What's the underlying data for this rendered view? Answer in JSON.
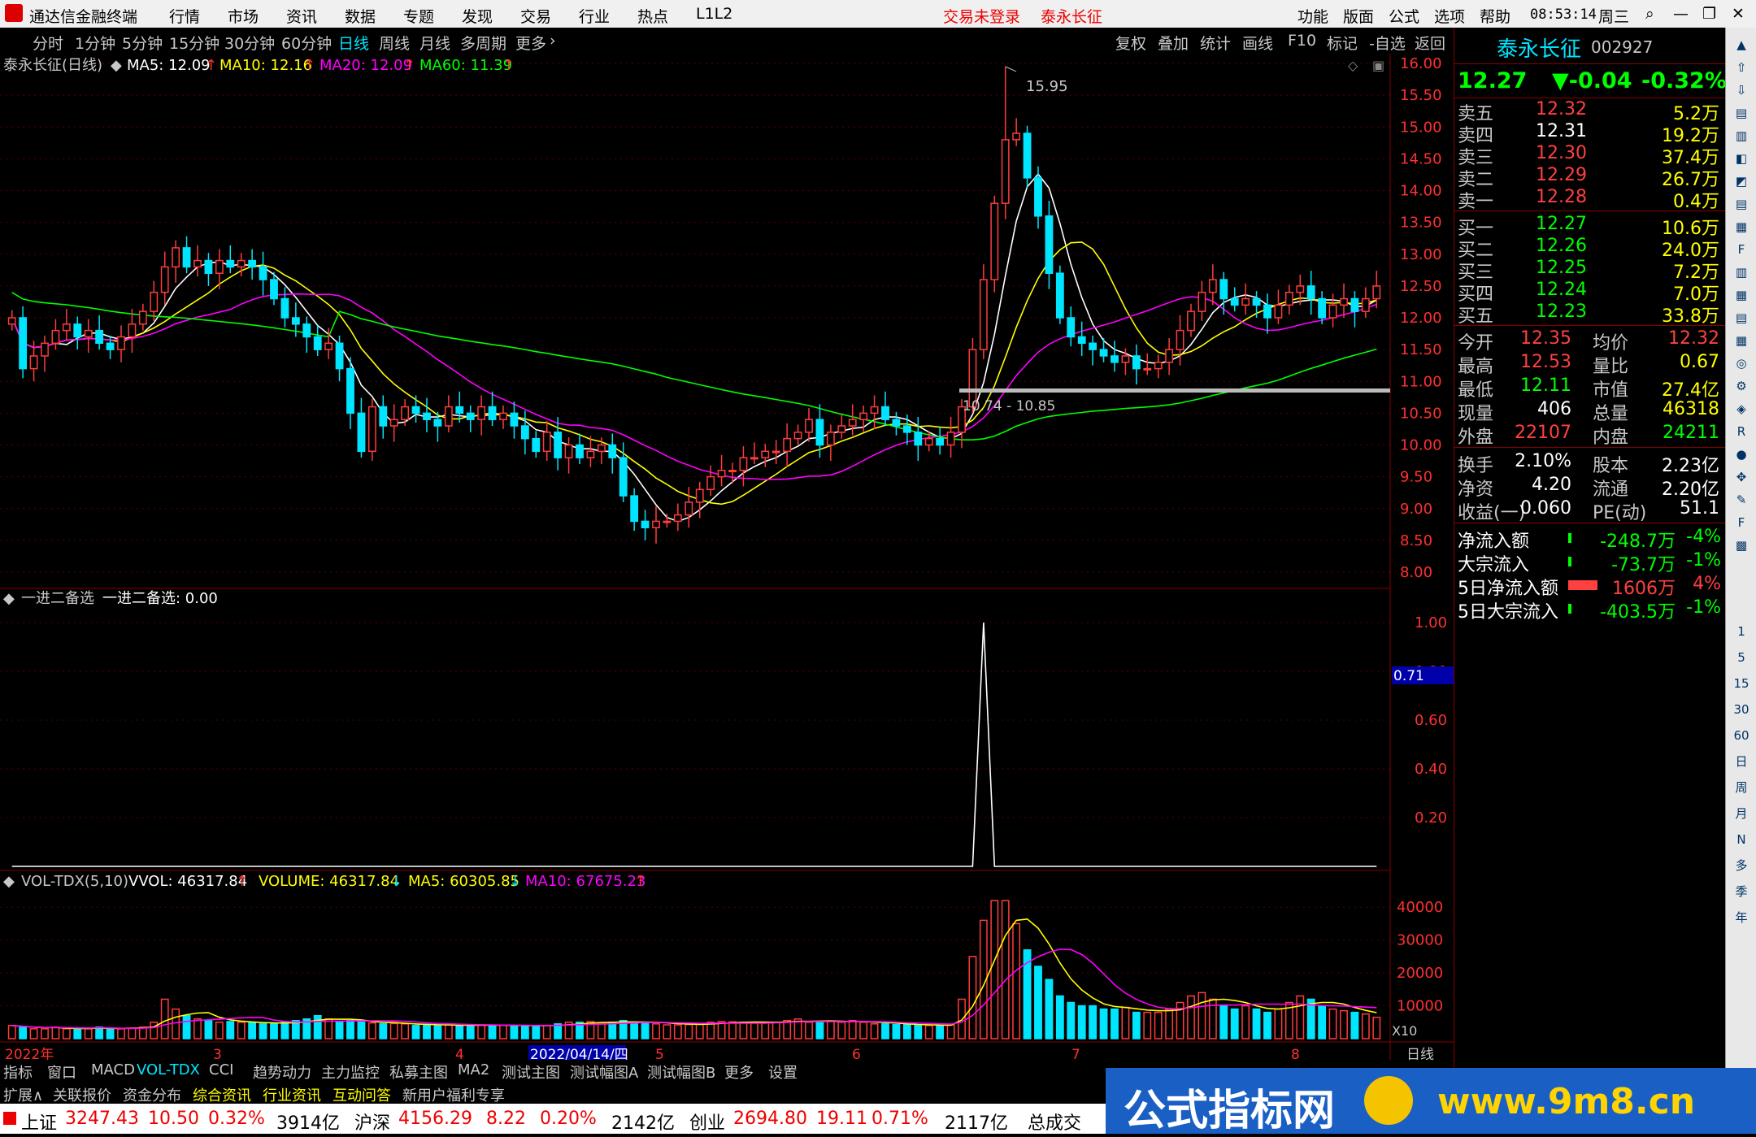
{
  "app": {
    "title": "通达信金融终端",
    "menu": [
      "行情",
      "市场",
      "资讯",
      "数据",
      "专题",
      "发现",
      "交易",
      "行业",
      "热点",
      "L1L2"
    ],
    "status_left": "交易未登录",
    "status_stock": "泰永长征",
    "right_menu": [
      "功能",
      "版面",
      "公式",
      "选项",
      "帮助"
    ],
    "time": "08:53:14",
    "weekday": "周三"
  },
  "toolbar": {
    "periods": [
      "分时",
      "1分钟",
      "5分钟",
      "15分钟",
      "30分钟",
      "60分钟",
      "日线",
      "周线",
      "月线",
      "多周期",
      "更多"
    ],
    "active_period": "日线",
    "right": [
      "复权",
      "叠加",
      "统计",
      "画线",
      "F10",
      "标记",
      "-自选",
      "返回"
    ]
  },
  "main_panel": {
    "name": "泰永长征(日线)",
    "ma": [
      {
        "label": "MA5: 12.09",
        "color": "#ffffff",
        "arrow": "↑"
      },
      {
        "label": "MA10: 12.16",
        "color": "#ffff00",
        "arrow": "↑"
      },
      {
        "label": "MA20: 12.09",
        "color": "#ff00ff",
        "arrow": "↑"
      },
      {
        "label": "MA60: 11.39",
        "color": "#00ff00",
        "arrow": "↑"
      }
    ],
    "y_ticks": [
      "16.00",
      "15.50",
      "15.00",
      "14.50",
      "14.00",
      "13.50",
      "13.00",
      "12.50",
      "12.00",
      "11.50",
      "11.00",
      "10.50",
      "10.00",
      "9.50",
      "9.00",
      "8.50",
      "8.00"
    ],
    "high_label": "15.95",
    "range_label": "10.74 - 10.85"
  },
  "indicator_panel": {
    "title": "一进二备选",
    "value_label": "一进二备选: 0.00",
    "y_ticks": [
      "1.00",
      "0.80",
      "0.60",
      "0.40",
      "0.20"
    ],
    "current": "0.71"
  },
  "volume_panel": {
    "name": "VOL-TDX(5,10)",
    "vvol": "VVOL: 46317.84",
    "volume": "VOLUME: 46317.84",
    "ma5": "MA5: 60305.85",
    "ma10": "MA10: 67675.23",
    "y_ticks": [
      "40000",
      "30000",
      "20000",
      "10000"
    ],
    "scale": "X10"
  },
  "x_axis": {
    "labels": [
      "2022年",
      "3",
      "4",
      "2022/04/14/四",
      "5",
      "6",
      "7",
      "8"
    ],
    "period": "日线"
  },
  "chart_data": {
    "type": "candlestick",
    "title": "泰永长征(日线)",
    "price_range": [
      8.0,
      16.0
    ],
    "max_high": 15.95,
    "last_close": 12.27,
    "moving_averages": {
      "MA5": 12.09,
      "MA10": 12.16,
      "MA20": 12.09,
      "MA60": 11.39
    },
    "closes": [
      12.0,
      11.2,
      11.4,
      11.6,
      11.8,
      11.9,
      11.7,
      11.8,
      11.6,
      11.5,
      11.7,
      11.9,
      12.1,
      12.4,
      12.8,
      13.1,
      12.8,
      12.9,
      12.7,
      12.9,
      12.8,
      12.9,
      12.8,
      12.6,
      12.3,
      12.0,
      11.9,
      11.7,
      11.5,
      11.6,
      11.2,
      10.5,
      9.9,
      10.6,
      10.3,
      10.4,
      10.6,
      10.5,
      10.4,
      10.3,
      10.6,
      10.5,
      10.4,
      10.6,
      10.4,
      10.5,
      10.3,
      10.1,
      9.9,
      10.2,
      9.8,
      10.0,
      9.8,
      9.9,
      10.0,
      9.8,
      9.2,
      8.8,
      8.7,
      8.8,
      8.8,
      8.9,
      9.1,
      9.3,
      9.5,
      9.6,
      9.6,
      9.8,
      9.8,
      9.9,
      9.9,
      10.1,
      10.2,
      10.4,
      10.0,
      10.2,
      10.3,
      10.4,
      10.5,
      10.6,
      10.4,
      10.3,
      10.2,
      10.0,
      10.1,
      10.0,
      10.2,
      10.6,
      11.5,
      12.6,
      13.8,
      14.8,
      14.9,
      14.2,
      13.6,
      12.7,
      12.0,
      11.7,
      11.6,
      11.5,
      11.4,
      11.3,
      11.4,
      11.2,
      11.2,
      11.3,
      11.5,
      11.8,
      12.1,
      12.4,
      12.6,
      12.3,
      12.2,
      12.3,
      12.2,
      12.0,
      12.2,
      12.4,
      12.5,
      12.3,
      12.0,
      12.2,
      12.3,
      12.1,
      12.3,
      12.5
    ],
    "volume_range": [
      0,
      45000
    ],
    "volumes": [
      4000,
      3500,
      3000,
      3000,
      3500,
      3000,
      3000,
      3000,
      3500,
      3200,
      3000,
      3200,
      3500,
      5000,
      12000,
      9000,
      7000,
      6000,
      5500,
      5000,
      5200,
      5000,
      4800,
      4500,
      4500,
      5000,
      5500,
      6000,
      7000,
      6000,
      5000,
      5500,
      5000,
      4800,
      4500,
      4600,
      4500,
      4000,
      4200,
      4000,
      4200,
      4100,
      4000,
      4200,
      4000,
      4100,
      4000,
      3900,
      3800,
      4000,
      4500,
      5000,
      5000,
      5200,
      4800,
      5000,
      5500,
      5000,
      5000,
      4500,
      4200,
      4200,
      4300,
      4500,
      5000,
      5200,
      5100,
      5000,
      5000,
      4800,
      5000,
      5500,
      6000,
      5000,
      5200,
      5200,
      5000,
      5500,
      5000,
      4500,
      4500,
      4300,
      4200,
      4100,
      4000,
      4000,
      4200,
      12000,
      25000,
      36000,
      42000,
      42000,
      35000,
      27000,
      22000,
      18000,
      13000,
      11000,
      10000,
      10000,
      9000,
      9000,
      9500,
      8000,
      8000,
      8000,
      9000,
      11000,
      13000,
      14000,
      12000,
      10000,
      9000,
      10000,
      9000,
      8000,
      9000,
      11000,
      13000,
      12000,
      10000,
      9000,
      8500,
      8000,
      7500,
      6500
    ],
    "signal_spike_index": 89,
    "signal_value": 1.0
  },
  "quote": {
    "name": "泰永长征",
    "code": "002927",
    "price": "12.27",
    "change": "▼-0.04",
    "change_pct": "-0.32%",
    "sells": [
      {
        "label": "卖五",
        "price": "12.32",
        "vol": "5.2万"
      },
      {
        "label": "卖四",
        "price": "12.31",
        "vol": "19.2万"
      },
      {
        "label": "卖三",
        "price": "12.30",
        "vol": "37.4万"
      },
      {
        "label": "卖二",
        "price": "12.29",
        "vol": "26.7万"
      },
      {
        "label": "卖一",
        "price": "12.28",
        "vol": "0.4万"
      }
    ],
    "buys": [
      {
        "label": "买一",
        "price": "12.27",
        "vol": "10.6万"
      },
      {
        "label": "买二",
        "price": "12.26",
        "vol": "24.0万"
      },
      {
        "label": "买三",
        "price": "12.25",
        "vol": "7.2万"
      },
      {
        "label": "买四",
        "price": "12.24",
        "vol": "7.0万"
      },
      {
        "label": "买五",
        "price": "12.23",
        "vol": "33.8万"
      }
    ],
    "stats": [
      {
        "l1": "今开",
        "v1": "12.35",
        "l2": "均价",
        "v2": "12.32"
      },
      {
        "l1": "最高",
        "v1": "12.53",
        "l2": "量比",
        "v2": "0.67"
      },
      {
        "l1": "最低",
        "v1": "12.11",
        "l2": "市值",
        "v2": "27.4亿"
      },
      {
        "l1": "现量",
        "v1": "406",
        "l2": "总量",
        "v2": "46318"
      },
      {
        "l1": "外盘",
        "v1": "22107",
        "l2": "内盘",
        "v2": "24211"
      }
    ],
    "fundamentals": [
      {
        "l1": "换手",
        "v1": "2.10%",
        "l2": "股本",
        "v2": "2.23亿"
      },
      {
        "l1": "净资",
        "v1": "4.20",
        "l2": "流通",
        "v2": "2.20亿"
      },
      {
        "l1": "收益(一)",
        "v1": "0.060",
        "l2": "PE(动)",
        "v2": "51.1"
      }
    ],
    "flows": [
      {
        "label": "净流入额",
        "value": "-248.7万",
        "pct": "-4%"
      },
      {
        "label": "大宗流入",
        "value": "-73.7万",
        "pct": "-1%"
      },
      {
        "label": "5日净流入额",
        "value": "1606万",
        "pct": "4%"
      },
      {
        "label": "5日大宗流入",
        "value": "-403.5万",
        "pct": "-1%"
      }
    ]
  },
  "sidebar": {
    "labels": [
      "1",
      "5",
      "15",
      "30",
      "60",
      "日",
      "周",
      "月",
      "N",
      "多",
      "季",
      "年"
    ]
  },
  "bottom_tabs": {
    "row1": [
      "指标",
      "窗口",
      "MACD",
      "VOL-TDX",
      "CCI",
      "趋势动力",
      "主力监控",
      "私募主图",
      "MA2",
      "测试主图",
      "测试幅图A",
      "测试幅图B",
      "更多",
      "设置"
    ],
    "row2": [
      "扩展∧",
      "关联报价",
      "资金分布",
      "综合资讯",
      "行业资讯",
      "互动问答",
      "新用户福利专享"
    ]
  },
  "statusbar": {
    "items": [
      {
        "name": "上证",
        "value": "3247.43",
        "chg": "10.50",
        "pct": "0.32%",
        "amt": "3914亿"
      },
      {
        "name": "沪深",
        "value": "4156.29",
        "chg": "8.22",
        "pct": "0.20%",
        "amt": "2142亿"
      },
      {
        "name": "创业",
        "value": "2694.80",
        "chg": "19.11",
        "pct": "0.71%",
        "amt": "2117亿"
      }
    ],
    "tail": "总成交"
  },
  "banner": {
    "text": "公式指标网",
    "url": "www.9m8.cn"
  }
}
